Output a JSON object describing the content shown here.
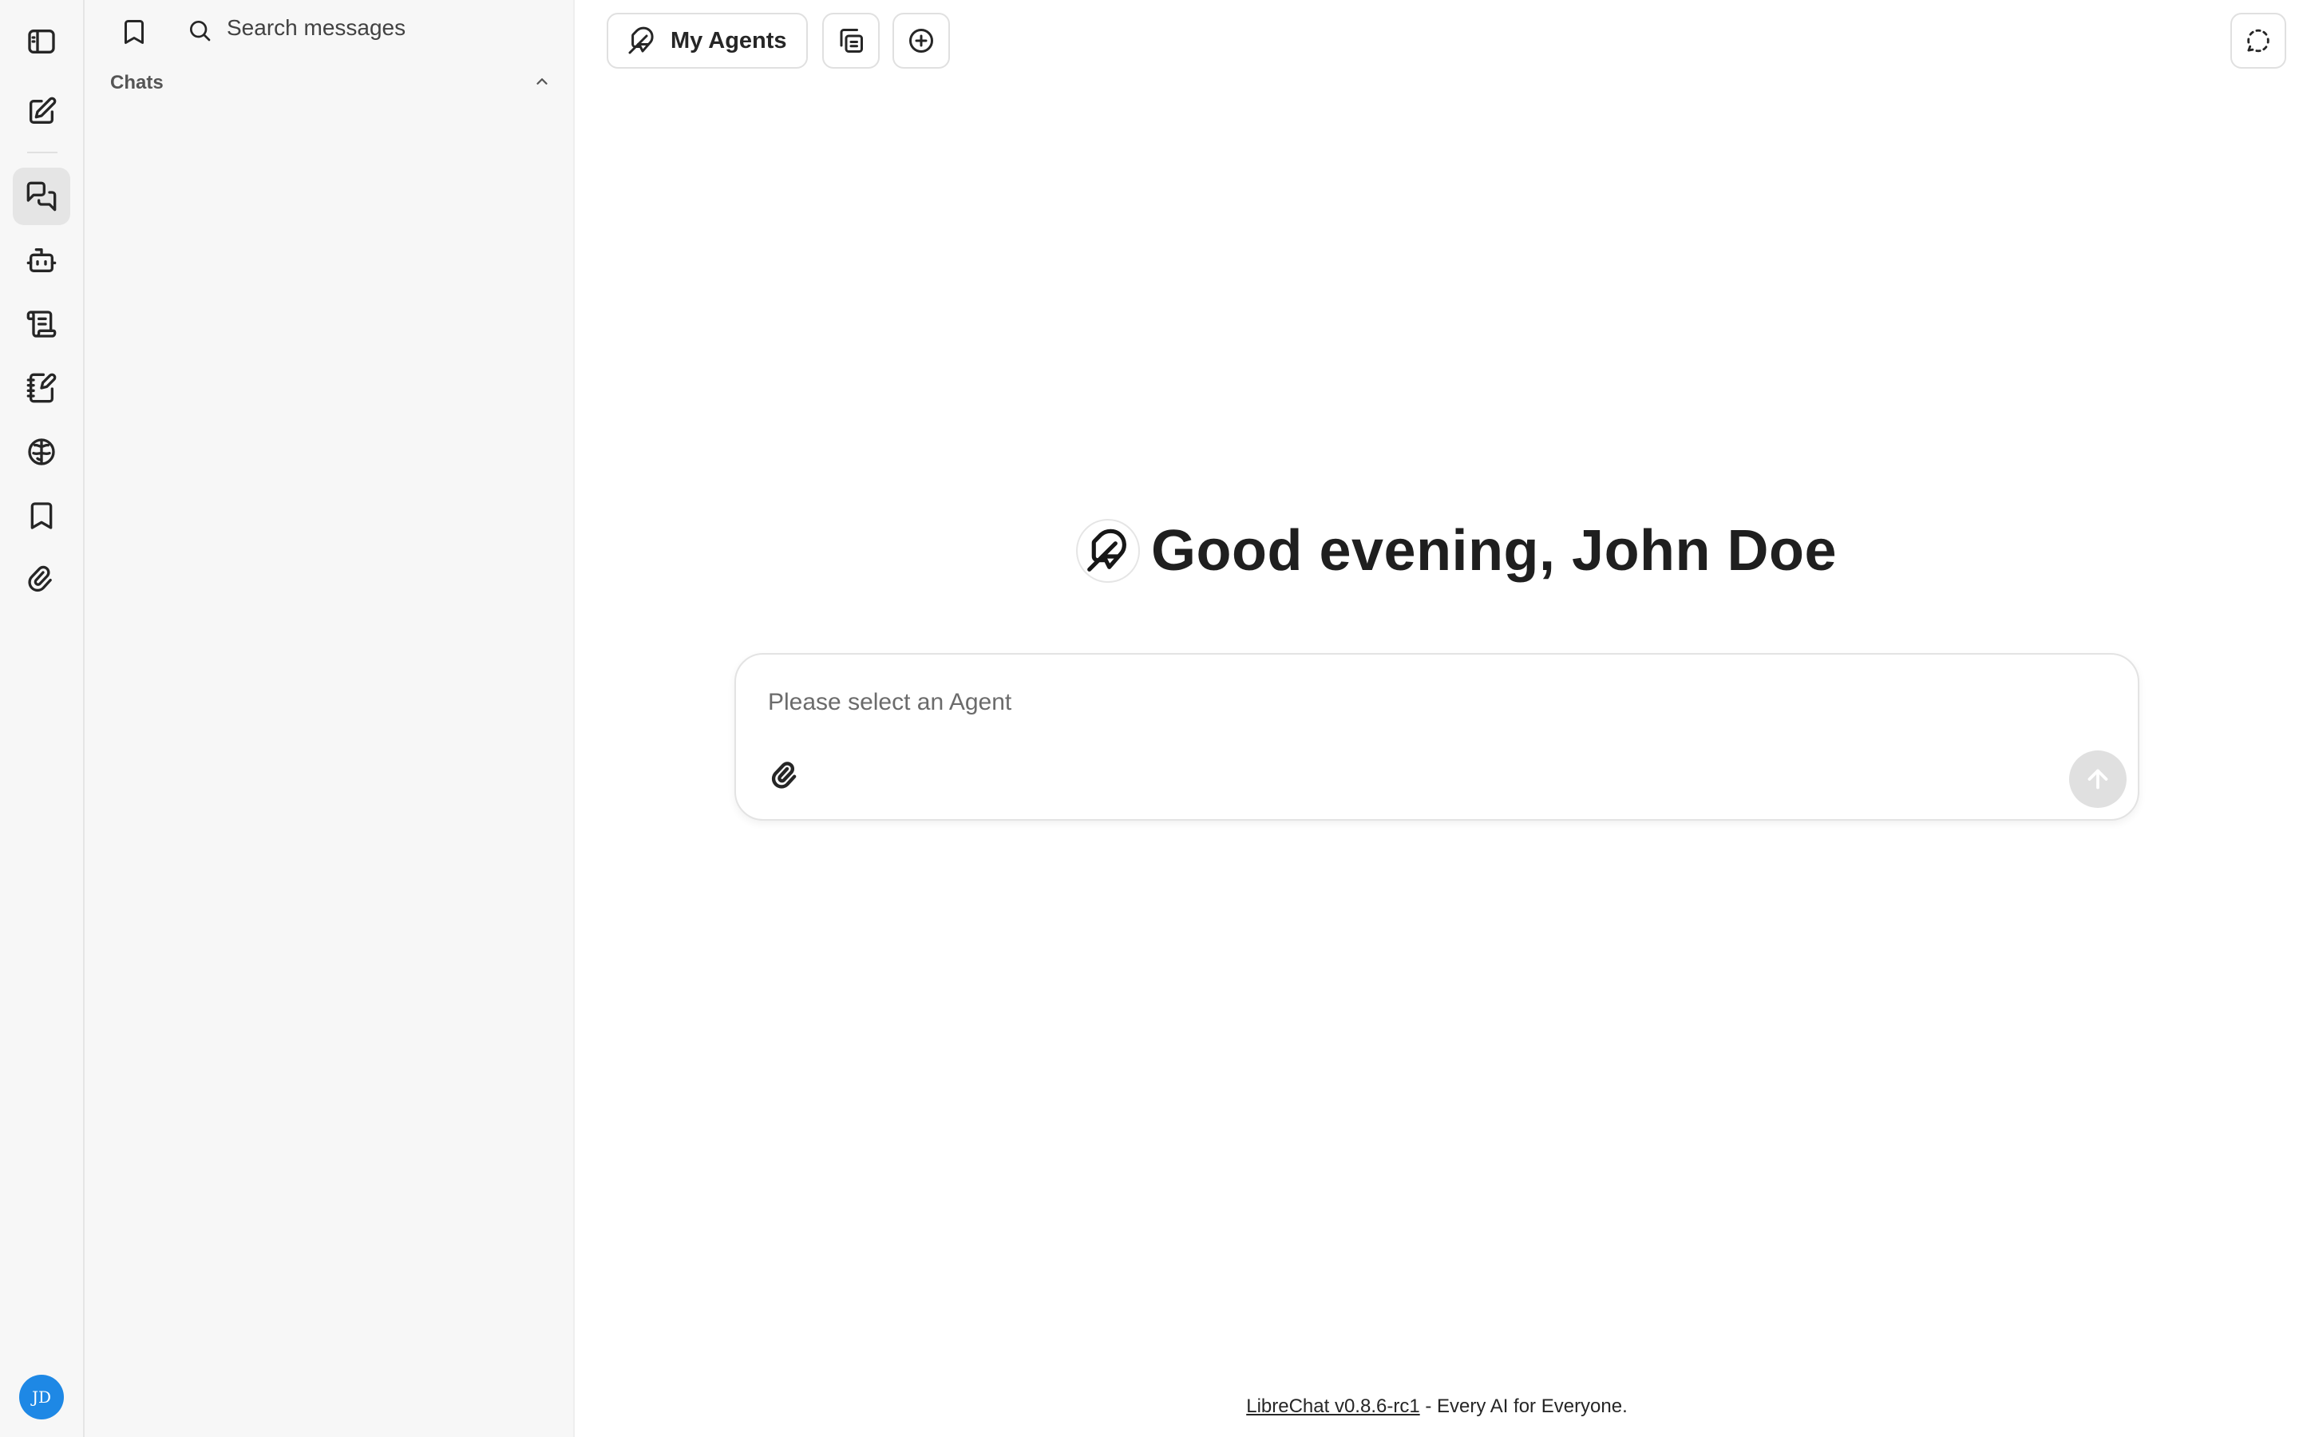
{
  "rail": {
    "items": [
      {
        "icon": "sidebar-toggle-icon"
      },
      {
        "icon": "new-chat-icon"
      },
      {
        "icon": "chats-icon",
        "active": true
      },
      {
        "icon": "agent-bot-icon"
      },
      {
        "icon": "prompts-icon"
      },
      {
        "icon": "notepad-icon"
      },
      {
        "icon": "memory-brain-icon"
      },
      {
        "icon": "bookmark-icon"
      },
      {
        "icon": "attachment-icon"
      }
    ],
    "avatar_initials": "JD",
    "avatar_color": "#1e88e5"
  },
  "panel": {
    "search_placeholder": "Search messages",
    "chats_label": "Chats"
  },
  "toolbar": {
    "agent_button_label": "My Agents"
  },
  "main": {
    "greeting": "Good evening, John Doe"
  },
  "composer": {
    "placeholder": "Please select an Agent"
  },
  "footer": {
    "link_text": "LibreChat v0.8.6-rc1",
    "suffix": " - Every AI for Everyone."
  }
}
